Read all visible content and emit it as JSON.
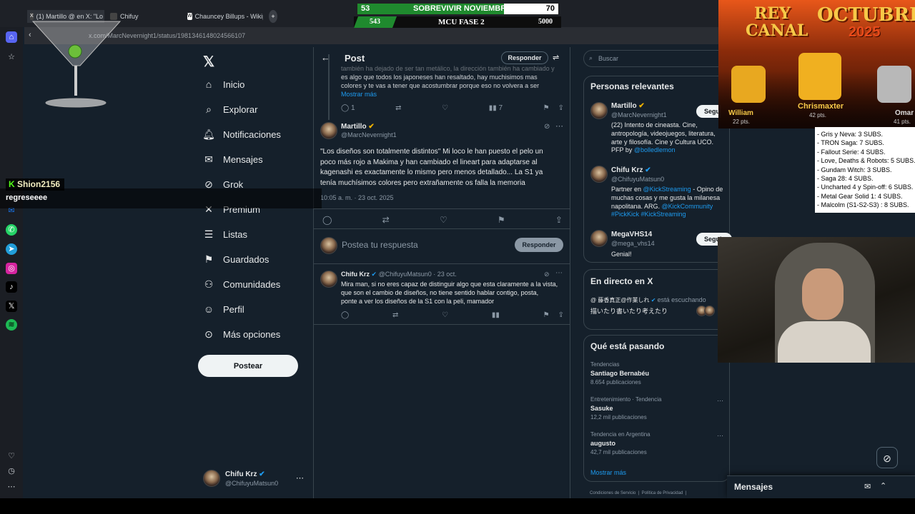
{
  "browser": {
    "tabs": [
      {
        "title": "(1) Martillo @ en X: \"Lo"
      },
      {
        "title": "Chifuy"
      },
      {
        "title": "Chauncey Billups - Wikip"
      }
    ],
    "new_tab": "+",
    "url": "x.com/MarcNevernight1/status/1981346148024566107"
  },
  "scoreboard": {
    "top": {
      "left": "53",
      "title": "SOBREVIVIR NOVIEMBRE",
      "right": "70"
    },
    "bottom": {
      "left": "543",
      "title": "MCU FASE 2",
      "right": "5000"
    }
  },
  "nav": {
    "items": [
      {
        "label": "Inicio",
        "icon": "home-icon"
      },
      {
        "label": "Explorar",
        "icon": "search-icon"
      },
      {
        "label": "Notificaciones",
        "icon": "bell-icon"
      },
      {
        "label": "Mensajes",
        "icon": "mail-icon"
      },
      {
        "label": "Grok",
        "icon": "grok-icon"
      },
      {
        "label": "Premium",
        "icon": "x-icon"
      },
      {
        "label": "Listas",
        "icon": "list-icon"
      },
      {
        "label": "Guardados",
        "icon": "bookmark-icon"
      },
      {
        "label": "Comunidades",
        "icon": "people-icon"
      },
      {
        "label": "Perfil",
        "icon": "person-icon"
      },
      {
        "label": "Más opciones",
        "icon": "more-icon"
      }
    ],
    "post_button": "Postear",
    "account": {
      "name": "Chifu Krz",
      "handle": "@ChifuyuMatsun0"
    }
  },
  "main": {
    "header_title": "Post",
    "reply_button": "Responder",
    "prev_tweet": {
      "text_line1": "también ha dejado de ser tan metálico, la dirección también ha cambiado y",
      "text_line2": "es algo que todos los japoneses han resaltado, hay muchisimos mas",
      "text_line3": "colores y te vas a tener que acostumbrar porque eso no volvera a ser",
      "show_more": "Mostrar más",
      "replies": "1",
      "views": "7"
    },
    "tweet": {
      "author": "Martillo",
      "handle": "@MarcNevernight1",
      "text_line1": "\"Los diseños son totalmente distintos\" Mi loco le han puesto el pelo un",
      "text_line2": "poco más rojo a Makima y han cambiado el lineart para adaptarse al",
      "text_line3": "kagenashi es exactamente lo mismo pero menos detallado... La S1 ya",
      "text_line4": "tenía muchísimos colores pero extrañamente os falla la memoria",
      "timestamp": "10:05 a. m. · 23 oct. 2025"
    },
    "compose": {
      "placeholder": "Postea tu respuesta",
      "button": "Responder"
    },
    "reply": {
      "author": "Chifu Krz",
      "handle": "@ChifuyuMatsun0 · 23 oct.",
      "text_line1": "Mira man, si no eres capaz de distinguir algo que esta claramente a la vista,",
      "text_line2": "que son el cambio de diseños, no tiene sentido hablar contigo, posta,",
      "text_line3": "ponte a ver los diseños de la S1 con la peli, mamador"
    }
  },
  "right": {
    "search_placeholder": "Buscar",
    "relevant": {
      "title": "Personas relevantes",
      "people": [
        {
          "name": "Martillo",
          "handle": "@MarcNevernight1",
          "follow": "Seguir",
          "bio1": "(22) Intento de cineasta. Cine,",
          "bio2": "antropología, videojuegos, literatura,",
          "bio3": "arte y filosofía. Cine y Cultura UCO.",
          "bio4a": "PFP by ",
          "bio4b": "@bolledlemon"
        },
        {
          "name": "Chifu Krz",
          "handle": "@ChifuyuMatsun0",
          "bio1a": "Partner en ",
          "bio1b": "@KickStreaming",
          "bio1c": " - Opino de",
          "bio2": "muchas cosas y me gusta la milanesa",
          "bio3a": "napolitana. ARG. ",
          "bio3b": "@KickCommunity",
          "bio4": "#PickKick #KickStreaming"
        },
        {
          "name": "MegaVHS14",
          "handle": "@mega_vhs14",
          "follow": "Seguir",
          "bio1": "Genial!"
        }
      ]
    },
    "live": {
      "title": "En directo en X",
      "user": "@ 藤香真正@作業しれ",
      "status": "está escuchando",
      "text": "描いたり書いたり考えたり"
    },
    "trends": {
      "title": "Qué está pasando",
      "items": [
        {
          "category": "Tendencias",
          "name": "Santiago Bernabéu",
          "posts": "8.654 publicaciones"
        },
        {
          "category": "Entretenimiento · Tendencia",
          "name": "Sasuke",
          "posts": "12,2 mil publicaciones"
        },
        {
          "category": "Tendencia en Argentina",
          "name": "augusto",
          "posts": "42,7 mil publicaciones"
        }
      ],
      "show_more": "Mostrar más"
    },
    "footer": "Condiciones de Servicio  |  Política de Privacidad  |"
  },
  "messages_dock": {
    "title": "Mensajes"
  },
  "chat": {
    "user": "Shion2156",
    "message": "regreseeee"
  },
  "overlay": {
    "banner_line1": "REY",
    "banner_line2": "CANAL",
    "banner_right1": "OCTUBRE",
    "banner_right2": "2025",
    "players": [
      {
        "name": "William",
        "pts": "22 pts."
      },
      {
        "name": "Chrismaxter",
        "pts": "42 pts."
      },
      {
        "name": "Omar",
        "pts": "41 pts."
      }
    ],
    "subs": [
      "- Gris y Neva: 3 SUBS.",
      "- TRON Saga: 7 SUBS.",
      "- Fallout Serie: 4 SUBS.",
      "- Love, Deaths & Robots: 5 SUBS.",
      "- Gundam Witch: 3 SUBS.",
      "- Saga 28: 4 SUBS.",
      "- Uncharted 4 y Spin-off: 6 SUBS.",
      "- Metal Gear Solid 1: 4 SUBS.",
      "- Malcolm (S1-S2-S3) : 8 SUBS."
    ]
  },
  "colors": {
    "x_bg": "#15202b",
    "accent": "#1d9bf0",
    "green": "#1f8a2e",
    "banner": "#e8571a"
  }
}
